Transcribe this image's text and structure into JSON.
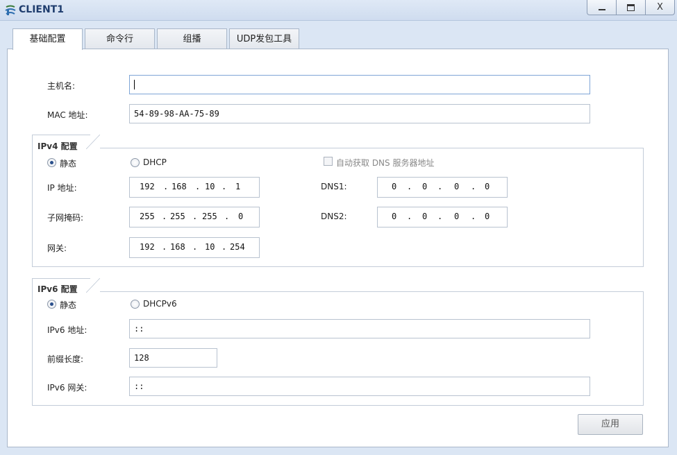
{
  "window": {
    "title": "CLIENT1",
    "minimize": "",
    "maximize": "",
    "close": "X"
  },
  "tabs": [
    {
      "label": "基础配置",
      "active": true
    },
    {
      "label": "命令行"
    },
    {
      "label": "组播"
    },
    {
      "label": "UDP发包工具"
    }
  ],
  "basic": {
    "hostname_label": "主机名:",
    "hostname_value": "",
    "mac_label": "MAC 地址:",
    "mac_value": "54-89-98-AA-75-89"
  },
  "ipv4": {
    "title": "IPv4 配置",
    "static_label": "静态",
    "dhcp_label": "DHCP",
    "auto_dns_label": "自动获取 DNS 服务器地址",
    "ip_label": "IP 地址:",
    "ip": [
      "192",
      "168",
      "10",
      "1"
    ],
    "mask_label": "子网掩码:",
    "mask": [
      "255",
      "255",
      "255",
      "0"
    ],
    "gateway_label": "网关:",
    "gateway": [
      "192",
      "168",
      "10",
      "254"
    ],
    "dns1_label": "DNS1:",
    "dns1": [
      "0",
      "0",
      "0",
      "0"
    ],
    "dns2_label": "DNS2:",
    "dns2": [
      "0",
      "0",
      "0",
      "0"
    ]
  },
  "ipv6": {
    "title": "IPv6 配置",
    "static_label": "静态",
    "dhcp_label": "DHCPv6",
    "addr_label": "IPv6 地址:",
    "addr_value": "::",
    "prefix_label": "前缀长度:",
    "prefix_value": "128",
    "gateway_label": "IPv6 网关:",
    "gateway_value": "::"
  },
  "apply_label": "应用"
}
